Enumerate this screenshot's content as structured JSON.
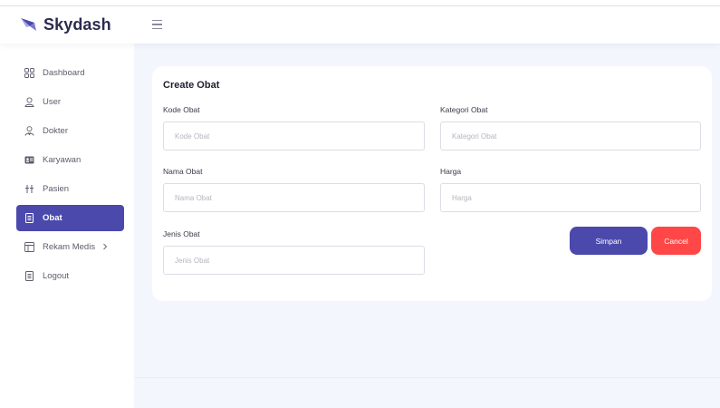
{
  "app": {
    "name": "Skydash"
  },
  "colors": {
    "primary": "#4b49ac",
    "danger": "#ff4747",
    "background": "#f4f6fd"
  },
  "header": {
    "menu_toggle_icon": "hamburger-icon"
  },
  "sidebar": {
    "items": [
      {
        "label": "Dashboard",
        "icon": "dashboard-grid-icon"
      },
      {
        "label": "User",
        "icon": "user-icon"
      },
      {
        "label": "Dokter",
        "icon": "doctor-icon"
      },
      {
        "label": "Karyawan",
        "icon": "id-card-icon"
      },
      {
        "label": "Pasien",
        "icon": "patient-icon"
      },
      {
        "label": "Obat",
        "icon": "document-icon",
        "active": true
      },
      {
        "label": "Rekam Medis",
        "icon": "layout-icon",
        "has_submenu": true
      },
      {
        "label": "Logout",
        "icon": "document-icon"
      }
    ]
  },
  "form": {
    "title": "Create Obat",
    "fields": {
      "kode_obat": {
        "label": "Kode Obat",
        "placeholder": "Kode Obat",
        "value": ""
      },
      "kategori_obat": {
        "label": "Kategori Obat",
        "placeholder": "Kategori Obat",
        "value": ""
      },
      "nama_obat": {
        "label": "Nama Obat",
        "placeholder": "Nama Obat",
        "value": ""
      },
      "harga": {
        "label": "Harga",
        "placeholder": "Harga",
        "value": ""
      },
      "jenis_obat": {
        "label": "Jenis Obat",
        "placeholder": "Jenis Obat",
        "value": ""
      }
    },
    "buttons": {
      "save": "Simpan",
      "cancel": "Cancel"
    }
  }
}
